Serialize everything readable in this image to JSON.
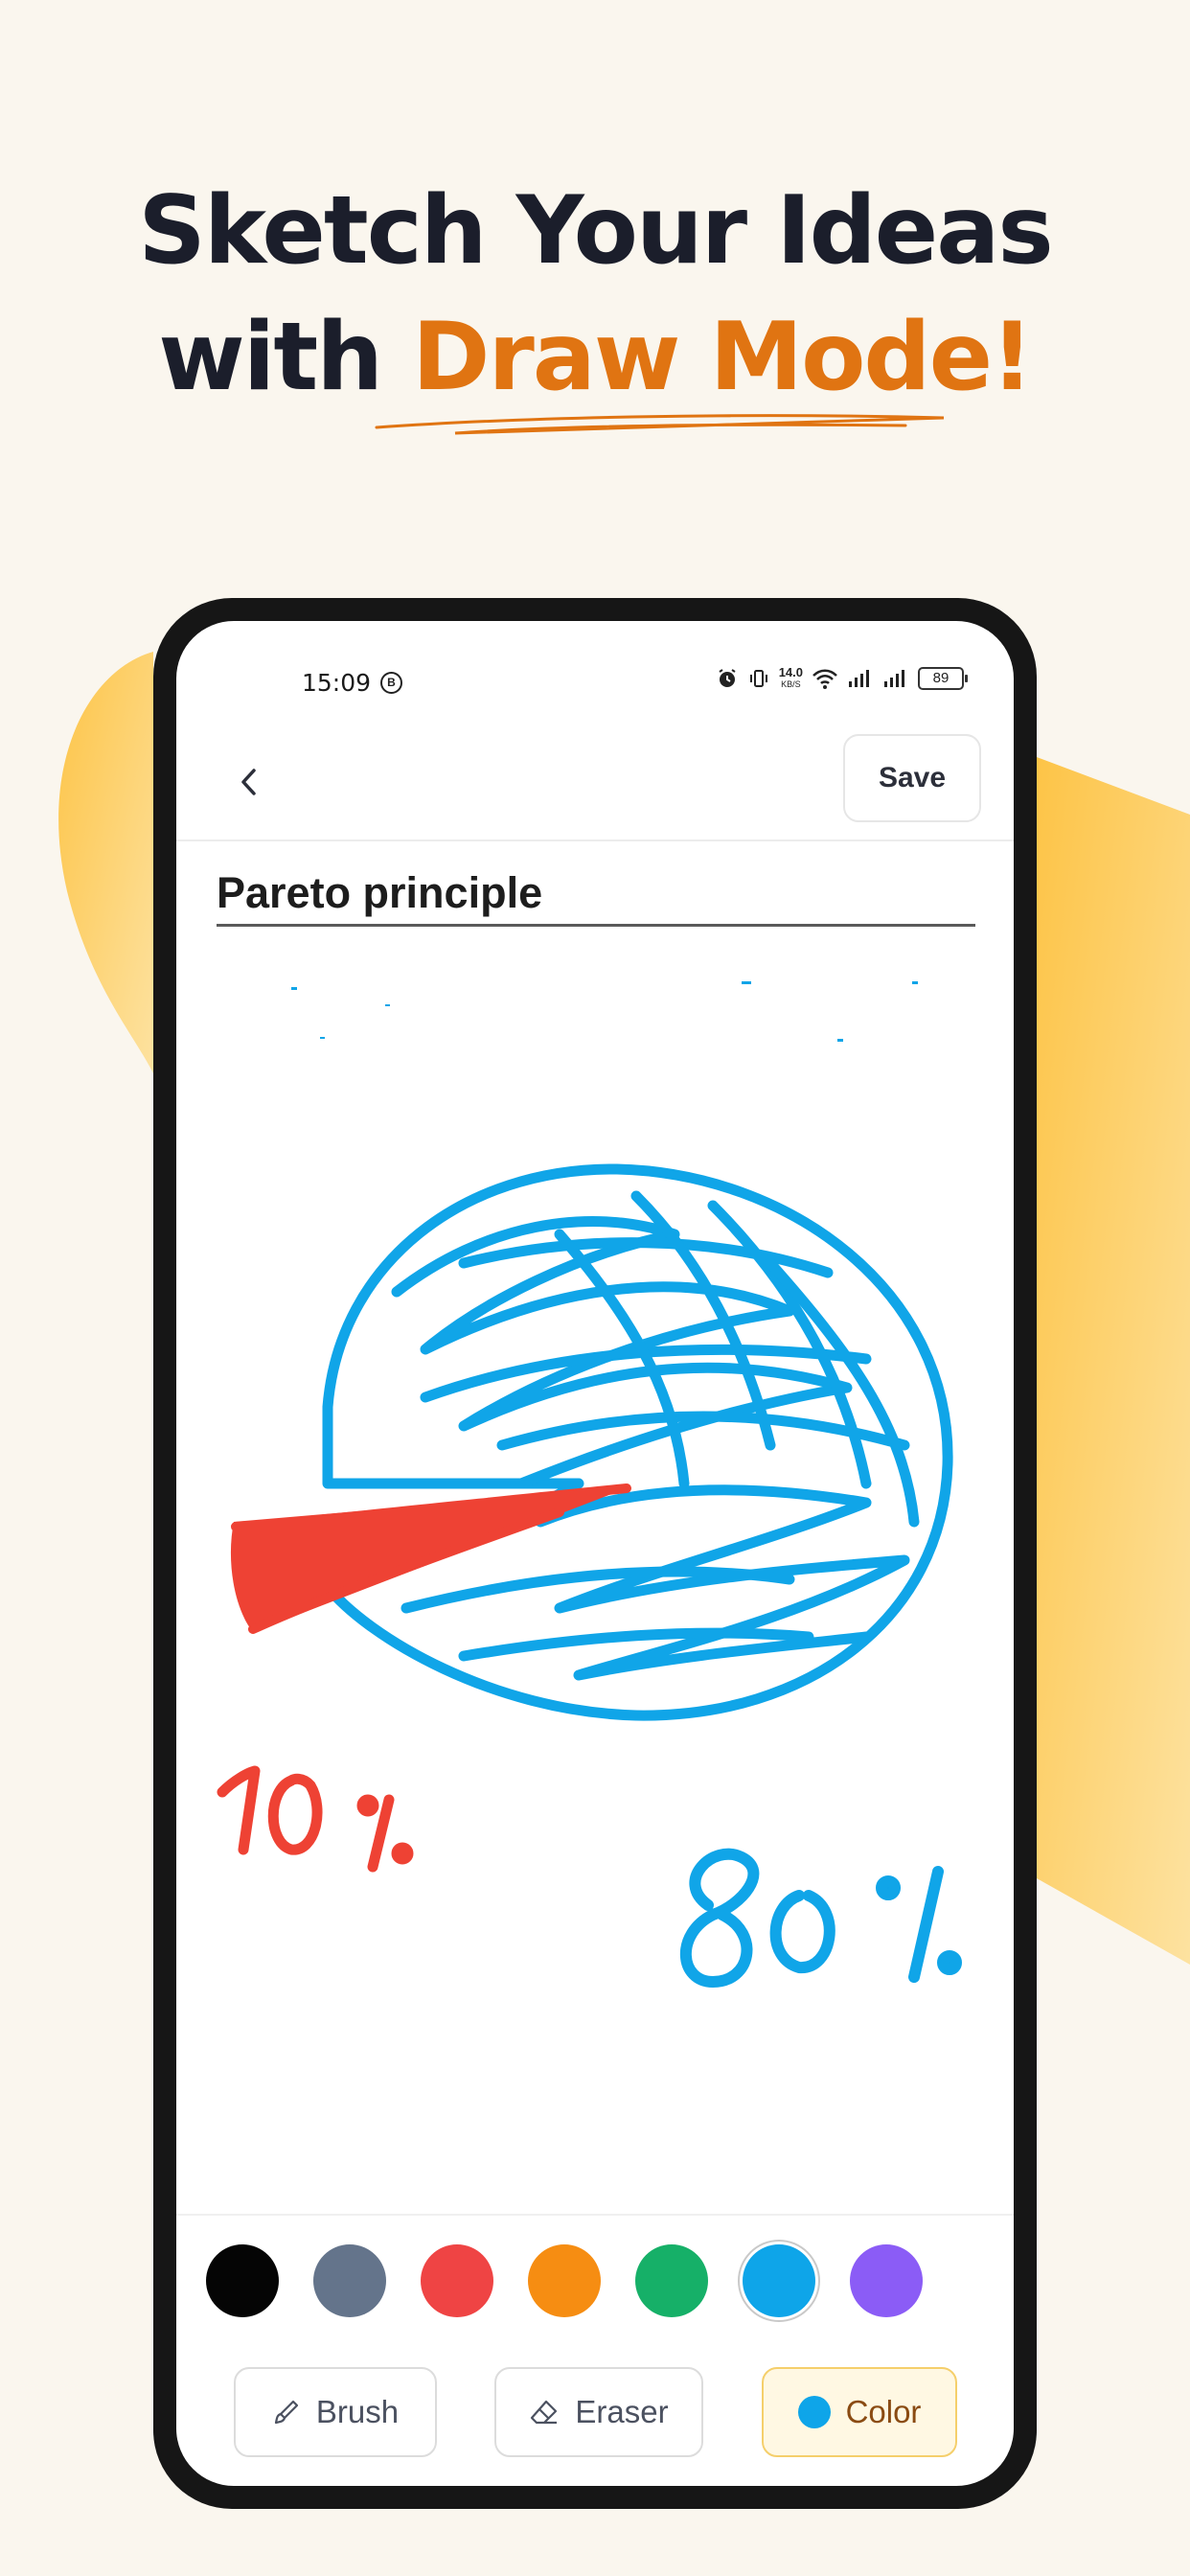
{
  "headline": {
    "line1": "Sketch Your Ideas",
    "line2_prefix": "with ",
    "line2_accent": "Draw Mode!"
  },
  "colors": {
    "accent": "#e07412",
    "blob": "#fcc94d",
    "blue_ink": "#10a5e8",
    "red_ink": "#ee4234"
  },
  "status_bar": {
    "time": "15:09",
    "b_badge": "B",
    "net_speed_value": "14.0",
    "net_speed_unit": "KB/S",
    "battery": "89"
  },
  "app_bar": {
    "back_icon": "chevron-left-icon",
    "save_label": "Save"
  },
  "note": {
    "title": "Pareto principle"
  },
  "drawing": {
    "label_small": "10%",
    "label_large": "80%"
  },
  "palette": [
    {
      "name": "black",
      "hex": "#050505",
      "selected": false
    },
    {
      "name": "slate",
      "hex": "#64748b",
      "selected": false
    },
    {
      "name": "red",
      "hex": "#ef4444",
      "selected": false
    },
    {
      "name": "orange",
      "hex": "#f68d12",
      "selected": false
    },
    {
      "name": "green",
      "hex": "#16b068",
      "selected": false
    },
    {
      "name": "blue",
      "hex": "#0ea5e9",
      "selected": true
    },
    {
      "name": "purple",
      "hex": "#8b5cf6",
      "selected": false
    }
  ],
  "tools": {
    "brush_label": "Brush",
    "brush_icon": "brush-icon",
    "eraser_label": "Eraser",
    "eraser_icon": "eraser-icon",
    "color_label": "Color",
    "active_tool": "Color"
  }
}
